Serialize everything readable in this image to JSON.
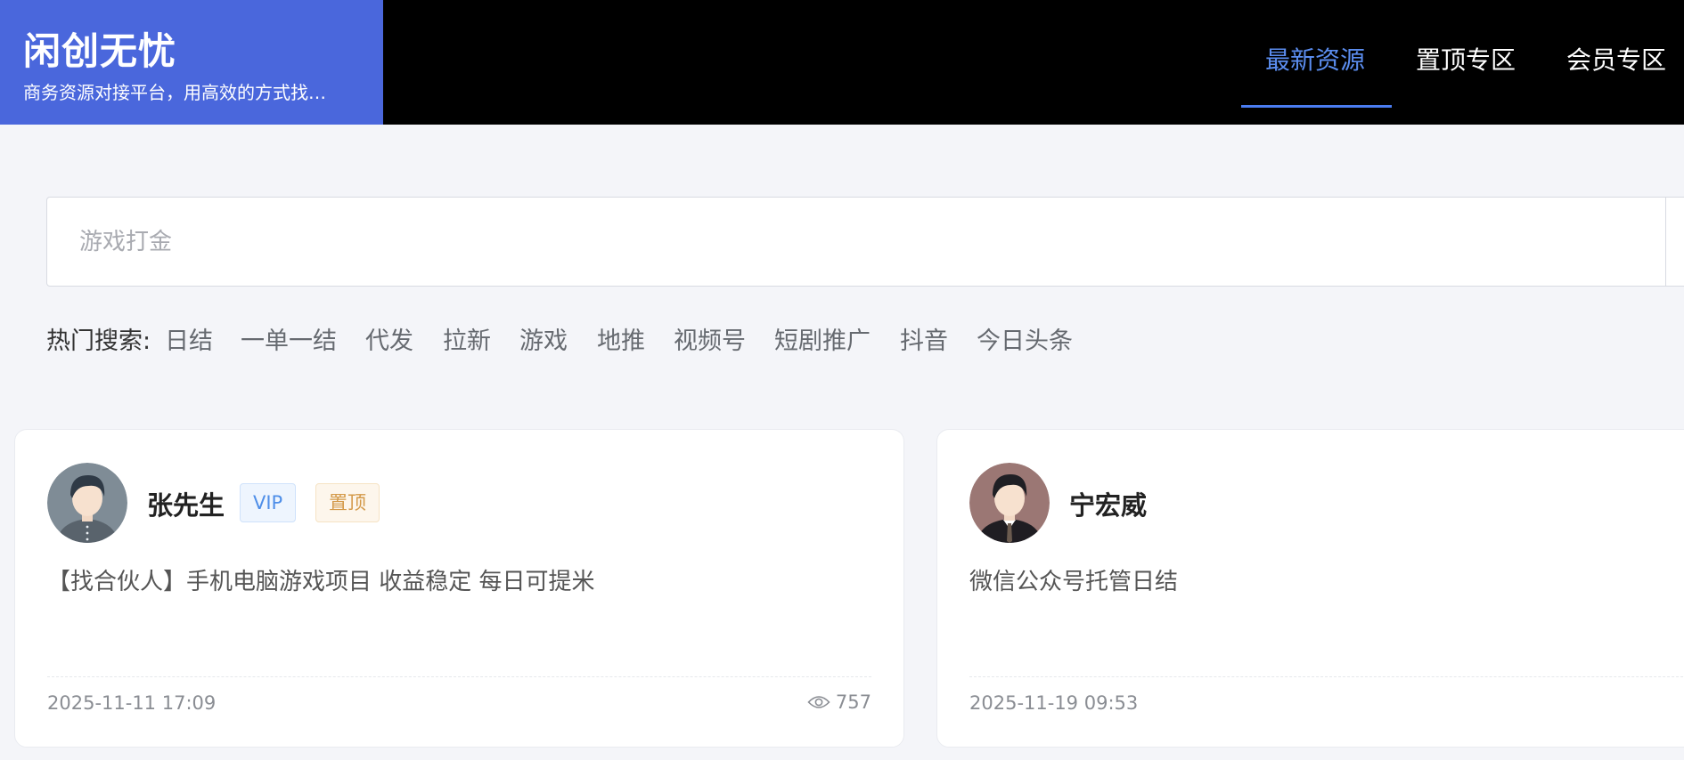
{
  "brand": {
    "title": "闲创无忧",
    "subtitle": "商务资源对接平台，用高效的方式找…"
  },
  "nav": {
    "items": [
      {
        "label": "最新资源",
        "active": true
      },
      {
        "label": "置顶专区",
        "active": false
      },
      {
        "label": "会员专区",
        "active": false
      }
    ]
  },
  "search": {
    "placeholder": "游戏打金",
    "value": ""
  },
  "hot_search": {
    "label": "热门搜索:",
    "items": [
      "日结",
      "一单一结",
      "代发",
      "拉新",
      "游戏",
      "地推",
      "视频号",
      "短剧推广",
      "抖音",
      "今日头条"
    ]
  },
  "cards": [
    {
      "name": "张先生",
      "badges": [
        "VIP",
        "置顶"
      ],
      "description": "【找合伙人】手机电脑游戏项目 收益稳定 每日可提米",
      "date": "2025-11-11 17:09",
      "views": "757",
      "avatar_icon": "male-user-avatar-icon"
    },
    {
      "name": "宁宏威",
      "badges": [],
      "description": "微信公众号托管日结",
      "date": "2025-11-19 09:53",
      "views": "",
      "avatar_icon": "male-suit-avatar-icon"
    }
  ],
  "colors": {
    "brand": "#4a67dc",
    "header": "#000000",
    "nav_active": "#5b8def",
    "vip_badge": "#4e8ee8",
    "top_badge": "#d49a4a",
    "page_bg": "#f4f5f9"
  }
}
